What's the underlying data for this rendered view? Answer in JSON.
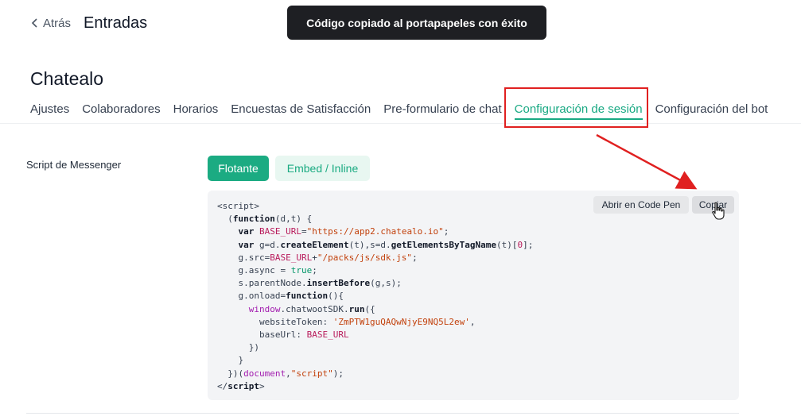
{
  "header": {
    "back_label": "Atrás",
    "title": "Entradas"
  },
  "toast": {
    "message": "Código copiado al portapapeles con éxito"
  },
  "inbox": {
    "name": "Chatealo"
  },
  "tabs": [
    {
      "label": "Ajustes"
    },
    {
      "label": "Colaboradores"
    },
    {
      "label": "Horarios"
    },
    {
      "label": "Encuestas de Satisfacción"
    },
    {
      "label": "Pre-formulario de chat"
    },
    {
      "label": "Configuración de sesión"
    },
    {
      "label": "Configuración del bot"
    }
  ],
  "script_section": {
    "label": "Script de Messenger",
    "btn_flotante": "Flotante",
    "btn_embed": "Embed / Inline",
    "btn_codepen": "Abrir en Code Pen",
    "btn_copy": "Copiar"
  },
  "code": {
    "base_url": "\"https://app2.chatealo.io\"",
    "sdk_path": "\"/packs/js/sdk.js\"",
    "website_token": "'ZmPTW1guQAQwNjyE9NQ5L2ew'"
  },
  "colors": {
    "accent": "#1bab82",
    "annotation": "#e02020",
    "toast_bg": "#1e1f23"
  }
}
